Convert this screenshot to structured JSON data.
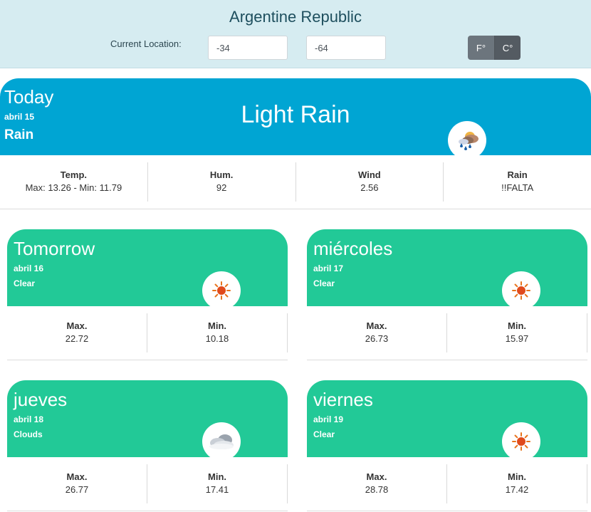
{
  "header": {
    "country": "Argentine Republic",
    "location_label": "Current Location:",
    "latitude": "-34",
    "longitude": "-64",
    "unit_f": "F°",
    "unit_c": "C°"
  },
  "today": {
    "day": "Today",
    "date": "abril 15",
    "condition": "Rain",
    "description": "Light Rain",
    "icon": "rain-cloud-icon",
    "stats": [
      {
        "label": "Temp.",
        "value": "Max: 13.26 - Min: 11.79"
      },
      {
        "label": "Hum.",
        "value": "92"
      },
      {
        "label": "Wind",
        "value": "2.56"
      },
      {
        "label": "Rain",
        "value": "!!FALTA"
      }
    ]
  },
  "forecast": [
    {
      "day": "Tomorrow",
      "date": "abril 16",
      "condition": "Clear",
      "icon": "sun-icon",
      "max_label": "Max.",
      "max": "22.72",
      "min_label": "Min.",
      "min": "10.18"
    },
    {
      "day": "miércoles",
      "date": "abril 17",
      "condition": "Clear",
      "icon": "sun-icon",
      "max_label": "Max.",
      "max": "26.73",
      "min_label": "Min.",
      "min": "15.97"
    },
    {
      "day": "jueves",
      "date": "abril 18",
      "condition": "Clouds",
      "icon": "cloud-icon",
      "max_label": "Max.",
      "max": "26.77",
      "min_label": "Min.",
      "min": "17.41"
    },
    {
      "day": "viernes",
      "date": "abril 19",
      "condition": "Clear",
      "icon": "sun-icon",
      "max_label": "Max.",
      "max": "28.78",
      "min_label": "Min.",
      "min": "17.42"
    }
  ],
  "colors": {
    "today_banner": "#00a5d3",
    "forecast_banner": "#22c997",
    "header_bg": "#d6ecf1"
  }
}
